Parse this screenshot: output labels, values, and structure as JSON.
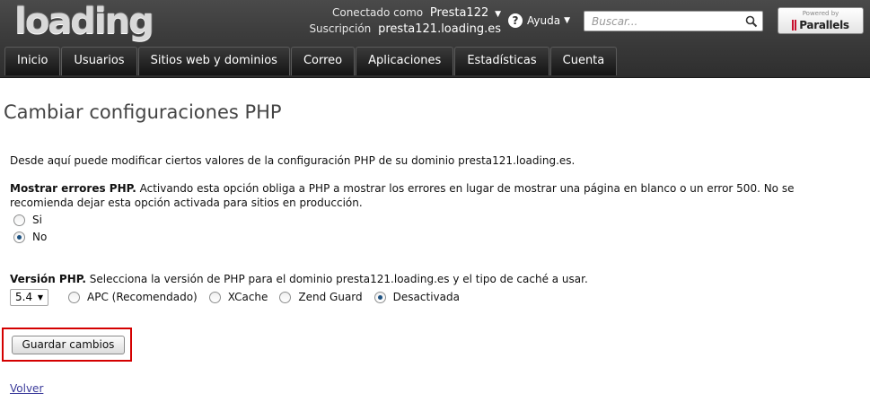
{
  "header": {
    "logo_text": "loading",
    "connected_label": "Conectado como",
    "username": "Presta122",
    "subscription_label": "Suscripción",
    "subscription_value": "presta121.loading.es",
    "help_label": "Ayuda",
    "search_placeholder": "Buscar...",
    "powered_small": "Powered by",
    "powered_name": "Parallels",
    "powered_accent": "#c8102e"
  },
  "nav": {
    "tabs": [
      "Inicio",
      "Usuarios",
      "Sitios web y dominios",
      "Correo",
      "Aplicaciones",
      "Estadísticas",
      "Cuenta"
    ]
  },
  "page": {
    "title": "Cambiar configuraciones PHP",
    "intro": "Desde aquí puede modificar ciertos valores de la configuración PHP de su dominio presta121.loading.es.",
    "errors_title": "Mostrar errores PHP.",
    "errors_text": "Activando esta opción obliga a PHP a mostrar los errores en lugar de mostrar una página en blanco o un error 500. No se recomienda dejar esta opción activada para sitios en producción.",
    "errors_options": [
      {
        "label": "Si",
        "checked": false
      },
      {
        "label": "No",
        "checked": true
      }
    ],
    "version_title": "Versión PHP.",
    "version_text": "Selecciona la versión de PHP para el dominio presta121.loading.es y el tipo de caché a usar.",
    "version_selected": "5.4",
    "cache_options": [
      {
        "label": "APC (Recomendado)",
        "checked": false
      },
      {
        "label": "XCache",
        "checked": false
      },
      {
        "label": "Zend Guard",
        "checked": false
      },
      {
        "label": "Desactivada",
        "checked": true
      }
    ],
    "save_label": "Guardar cambios",
    "back_label": "Volver",
    "highlight_color": "#d40000"
  }
}
